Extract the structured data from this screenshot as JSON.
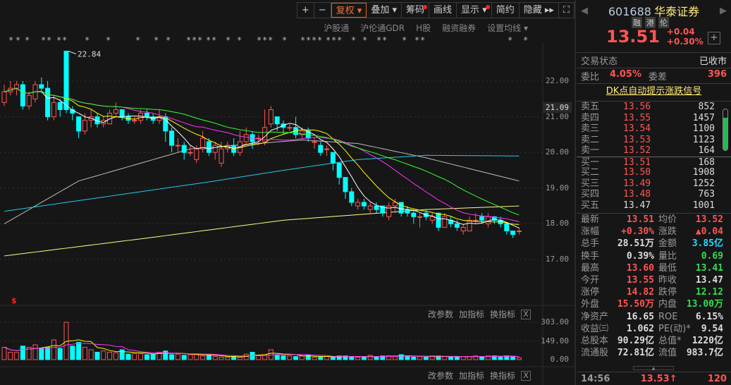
{
  "toolbar": {
    "plus": "+",
    "minus": "−",
    "fuquan": "复权 ▾",
    "diejia": "叠加 ▾",
    "chouma": "筹码",
    "huaxian": "画线",
    "xianshi": "显示 ▾",
    "jianyue": "简约",
    "yincang": "隐藏 ▸▸",
    "fullscreen": "⛶"
  },
  "subbar": {
    "items": [
      "沪股通",
      "沪伦通GDR",
      "H股",
      "融资融券",
      "设置均线 ▾"
    ]
  },
  "chart_data": {
    "type": "candlestick",
    "price_axis": {
      "ticks": [
        "22.00",
        "21.00",
        "20.00",
        "19.00",
        "18.00",
        "17.00"
      ],
      "range": [
        16.6,
        23.0
      ]
    },
    "current_price_label": "21.09",
    "max_annotation": "22.84",
    "ohlc": [
      [
        21.4,
        21.7,
        21.9,
        21.3
      ],
      [
        21.7,
        21.8,
        22.0,
        21.6
      ],
      [
        21.8,
        21.9,
        22.0,
        21.6
      ],
      [
        21.9,
        21.3,
        22.0,
        21.2
      ],
      [
        21.3,
        21.6,
        21.7,
        21.2
      ],
      [
        21.5,
        21.9,
        22.0,
        21.4
      ],
      [
        21.9,
        21.8,
        22.1,
        21.7
      ],
      [
        21.8,
        21.0,
        22.0,
        20.9
      ],
      [
        21.0,
        21.4,
        21.6,
        20.9
      ],
      [
        21.4,
        21.2,
        21.5,
        21.0
      ],
      [
        22.84,
        21.2,
        22.84,
        21.1
      ],
      [
        21.2,
        21.1,
        21.3,
        20.9
      ],
      [
        21.0,
        20.6,
        21.0,
        20.4
      ],
      [
        20.6,
        20.9,
        21.1,
        20.5
      ],
      [
        20.9,
        21.0,
        21.2,
        20.7
      ],
      [
        21.0,
        20.8,
        21.1,
        20.7
      ],
      [
        20.8,
        20.9,
        21.0,
        20.7
      ],
      [
        20.8,
        21.1,
        21.2,
        20.8
      ],
      [
        21.1,
        21.2,
        21.4,
        21.0
      ],
      [
        21.2,
        21.0,
        21.2,
        20.9
      ],
      [
        21.0,
        20.9,
        21.1,
        20.8
      ],
      [
        20.9,
        20.9,
        21.0,
        20.8
      ],
      [
        20.9,
        21.1,
        21.2,
        20.8
      ],
      [
        21.1,
        21.0,
        21.2,
        20.9
      ],
      [
        21.0,
        20.9,
        21.1,
        20.8
      ],
      [
        20.9,
        21.0,
        21.2,
        20.8
      ],
      [
        21.0,
        20.6,
        21.1,
        20.3
      ],
      [
        20.6,
        20.2,
        20.7,
        20.0
      ],
      [
        20.2,
        20.2,
        20.4,
        20.0
      ],
      [
        20.2,
        20.0,
        20.3,
        19.8
      ],
      [
        20.0,
        20.0,
        20.2,
        19.9
      ],
      [
        19.8,
        20.1,
        20.2,
        19.7
      ],
      [
        20.1,
        20.4,
        20.6,
        20.0
      ],
      [
        20.3,
        20.0,
        20.4,
        19.9
      ],
      [
        20.0,
        20.2,
        20.3,
        19.8
      ],
      [
        19.7,
        20.1,
        20.3,
        19.6
      ],
      [
        20.1,
        20.2,
        20.3,
        20.0
      ],
      [
        20.2,
        20.0,
        20.4,
        19.9
      ],
      [
        20.0,
        20.3,
        20.6,
        19.9
      ],
      [
        20.3,
        20.5,
        20.7,
        20.2
      ],
      [
        20.5,
        20.3,
        20.6,
        20.1
      ],
      [
        20.4,
        20.4,
        20.5,
        20.2
      ],
      [
        20.3,
        20.7,
        21.2,
        20.2
      ],
      [
        20.8,
        21.2,
        21.3,
        20.7
      ],
      [
        21.0,
        20.8,
        21.0,
        20.6
      ],
      [
        20.8,
        20.7,
        20.9,
        20.5
      ],
      [
        20.7,
        20.7,
        20.8,
        20.6
      ],
      [
        20.7,
        20.5,
        21.0,
        20.4
      ],
      [
        20.5,
        20.6,
        20.7,
        20.4
      ],
      [
        20.6,
        20.4,
        20.7,
        20.3
      ],
      [
        20.3,
        20.3,
        20.4,
        20.1
      ],
      [
        20.2,
        20.0,
        20.3,
        19.9
      ],
      [
        20.1,
        20.1,
        20.2,
        19.9
      ],
      [
        20.0,
        19.7,
        20.0,
        19.5
      ],
      [
        19.7,
        19.3,
        19.7,
        19.1
      ],
      [
        19.3,
        18.9,
        19.3,
        18.7
      ],
      [
        18.9,
        18.6,
        19.0,
        18.5
      ],
      [
        18.5,
        18.6,
        18.7,
        18.4
      ],
      [
        18.6,
        18.5,
        18.7,
        18.4
      ],
      [
        18.4,
        18.5,
        18.6,
        18.3
      ],
      [
        18.5,
        18.4,
        18.6,
        18.3
      ],
      [
        18.5,
        18.3,
        18.5,
        18.2
      ],
      [
        18.2,
        18.5,
        18.6,
        18.1
      ],
      [
        18.5,
        18.6,
        18.7,
        18.3
      ],
      [
        18.6,
        18.3,
        18.6,
        18.2
      ],
      [
        18.4,
        18.3,
        18.5,
        18.2
      ],
      [
        18.3,
        18.2,
        18.4,
        18.0
      ],
      [
        18.2,
        18.2,
        18.3,
        17.9
      ],
      [
        18.3,
        18.2,
        18.4,
        18.1
      ],
      [
        18.1,
        18.2,
        18.3,
        18.0
      ],
      [
        18.3,
        17.9,
        18.3,
        17.8
      ],
      [
        17.9,
        18.2,
        18.3,
        17.9
      ],
      [
        18.1,
        18.0,
        18.2,
        17.9
      ],
      [
        18.0,
        17.9,
        18.1,
        17.8
      ],
      [
        17.8,
        17.9,
        18.0,
        17.7
      ],
      [
        17.8,
        18.1,
        18.2,
        17.8
      ],
      [
        18.1,
        18.1,
        18.3,
        18.0
      ],
      [
        18.2,
        18.1,
        18.3,
        18.0
      ],
      [
        18.0,
        18.2,
        18.3,
        17.9
      ],
      [
        18.2,
        18.1,
        18.2,
        18.0
      ],
      [
        18.1,
        18.0,
        18.2,
        17.9
      ],
      [
        18.0,
        17.8,
        18.0,
        17.7
      ],
      [
        17.8,
        17.7,
        17.8,
        17.6
      ],
      [
        17.8,
        17.8,
        17.9,
        17.7
      ]
    ],
    "ma_computed": [
      {
        "period": 5,
        "color": "#ffffff"
      },
      {
        "period": 10,
        "color": "#ffff00"
      },
      {
        "period": 20,
        "color": "#ff33ff"
      },
      {
        "period": 30,
        "color": "#33ff33"
      }
    ],
    "ma_long": [
      {
        "name": "MA60",
        "color": "#bbbbbb",
        "anchors": [
          [
            0,
            18.0
          ],
          [
            12,
            19.2
          ],
          [
            30,
            20.1
          ],
          [
            48,
            20.35
          ],
          [
            57,
            20.25
          ],
          [
            68,
            19.85
          ],
          [
            83,
            19.2
          ]
        ]
      },
      {
        "name": "MA120",
        "color": "#22ccee",
        "anchors": [
          [
            0,
            18.35
          ],
          [
            34,
            19.2
          ],
          [
            45,
            19.5
          ],
          [
            57,
            19.8
          ],
          [
            68,
            19.92
          ],
          [
            83,
            19.9
          ]
        ]
      },
      {
        "name": "MA250",
        "color": "#ffff88",
        "anchors": [
          [
            0,
            17.1
          ],
          [
            23,
            17.6
          ],
          [
            45,
            18.1
          ],
          [
            68,
            18.4
          ],
          [
            83,
            18.5
          ]
        ]
      }
    ],
    "volume": {
      "ticks": [
        "303.00",
        "149.00",
        "0.00"
      ],
      "max": 303,
      "values": [
        100,
        60,
        58,
        110,
        100,
        120,
        90,
        100,
        160,
        90,
        303,
        110,
        140,
        100,
        80,
        60,
        70,
        60,
        55,
        80,
        45,
        50,
        50,
        40,
        45,
        60,
        70,
        40,
        45,
        35,
        40,
        45,
        30,
        38,
        25,
        20,
        20,
        25,
        20,
        45,
        60,
        35,
        40,
        80,
        40,
        30,
        30,
        25,
        30,
        35,
        20,
        20,
        25,
        20,
        30,
        30,
        25,
        20,
        20,
        35,
        25,
        30,
        30,
        25,
        40,
        30,
        20,
        25,
        20,
        30,
        30,
        25,
        20,
        25,
        25,
        25,
        30,
        20,
        30,
        30,
        25,
        30,
        25,
        15
      ]
    }
  },
  "ind_bar": {
    "gcs": "改参数",
    "jzb": "加指标",
    "hzb": "换指标",
    "close": "X"
  },
  "quote": {
    "code": "601688",
    "name": "华泰证券",
    "tags": [
      "融",
      "港",
      "伦"
    ],
    "price": "13.51",
    "chg": "+0.04",
    "pct": "+0.30%",
    "add": "+",
    "status_label": "交易状态",
    "status": "已收市",
    "wb_label": "委比",
    "wb": "4.05%",
    "wc_label": "委差",
    "wc": "396",
    "dk_link": "DK点自动提示涨跌信号",
    "asks": [
      [
        "卖五",
        "13.56",
        "852"
      ],
      [
        "卖四",
        "13.55",
        "1457"
      ],
      [
        "卖三",
        "13.54",
        "1100"
      ],
      [
        "卖二",
        "13.53",
        "1123"
      ],
      [
        "卖一",
        "13.52",
        "164"
      ]
    ],
    "bids": [
      [
        "买一",
        "13.51",
        "168"
      ],
      [
        "买二",
        "13.50",
        "1908"
      ],
      [
        "买三",
        "13.49",
        "1252"
      ],
      [
        "买四",
        "13.48",
        "763"
      ],
      [
        "买五",
        "13.47",
        "1001"
      ]
    ],
    "stats": [
      [
        "最新",
        "13.51",
        "均价",
        "13.52"
      ],
      [
        "涨幅",
        "+0.30%",
        "涨跌",
        "▲0.04"
      ],
      [
        "总手",
        "28.51万",
        "金额",
        "3.85亿"
      ],
      [
        "换手",
        "0.39%",
        "量比",
        "0.69"
      ],
      [
        "最高",
        "13.60",
        "最低",
        "13.41"
      ],
      [
        "今开",
        "13.55",
        "昨收",
        "13.47"
      ],
      [
        "涨停",
        "14.82",
        "跌停",
        "12.12"
      ],
      [
        "外盘",
        "15.50万",
        "内盘",
        "13.00万"
      ],
      [
        "净资产",
        "16.65",
        "ROE",
        "6.15%"
      ],
      [
        "收益㈢",
        "1.062",
        "PE(动)*",
        "9.54"
      ],
      [
        "总股本",
        "90.29亿",
        "总值*",
        "1220亿"
      ],
      [
        "流通股",
        "72.81亿",
        "流值",
        "983.7亿"
      ]
    ],
    "tick": {
      "time": "14:56",
      "price": "13.53↑",
      "vol": "120"
    }
  },
  "colors": {
    "up": "#ff5555",
    "down": "#00ffff"
  }
}
